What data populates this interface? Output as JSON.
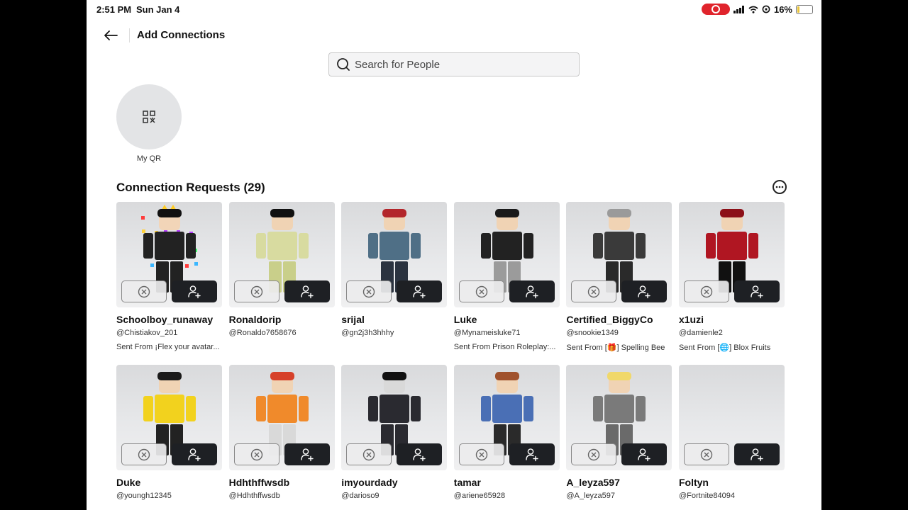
{
  "status": {
    "time": "2:51 PM",
    "date": "Sun Jan 4",
    "battery": "16%",
    "battery_level": 0.16
  },
  "header": {
    "title": "Add Connections"
  },
  "search": {
    "placeholder": "Search for People"
  },
  "qr": {
    "label": "My QR"
  },
  "section": {
    "title": "Connection Requests (29)"
  },
  "colors": {
    "accept_bg": "#1e2024",
    "record_red": "#e0242c",
    "tile_bg": "#e4e5e7"
  },
  "requests": [
    {
      "name": "Schoolboy_runaway",
      "handle": "@Chistiakov_201",
      "sent": "Sent From ¡Flex your avatar...",
      "shirt": "#222",
      "skin": "#f2d5b8",
      "pants": "#222",
      "hair": "#111",
      "deco": "rainbow"
    },
    {
      "name": "Ronaldorip",
      "handle": "@Ronaldo7658676",
      "sent": "",
      "shirt": "#d8dba0",
      "skin": "#f0d3b4",
      "pants": "#c9cf8a",
      "hair": "#111",
      "deco": ""
    },
    {
      "name": "srijal",
      "handle": "@gn2j3h3hhhy",
      "sent": "",
      "shirt": "#4f6f86",
      "skin": "#f0d3b4",
      "pants": "#2b3340",
      "hair": "#b3262b",
      "deco": ""
    },
    {
      "name": "Luke",
      "handle": "@Mynameisluke71",
      "sent": "Sent From Prison Roleplay:...",
      "shirt": "#222",
      "skin": "#f0d3b4",
      "pants": "#9b9b9b",
      "hair": "#1a1a1a",
      "deco": ""
    },
    {
      "name": "Certified_BiggyCo",
      "handle": "@snookie1349",
      "sent": "Sent From [🎁] Spelling Bee",
      "shirt": "#3a3a3a",
      "skin": "#f0d3b4",
      "pants": "#2a2a2a",
      "hair": "#9a9a9a",
      "deco": ""
    },
    {
      "name": "x1uzi",
      "handle": "@damienle2",
      "sent": "Sent From [🌐] Blox Fruits",
      "shirt": "#b01622",
      "skin": "#f0d3b4",
      "pants": "#111",
      "hair": "#8c1018",
      "deco": ""
    },
    {
      "name": "Duke",
      "handle": "@youngh12345",
      "sent": "",
      "shirt": "#f2d21e",
      "skin": "#f0d3b4",
      "pants": "#222",
      "hair": "#1a1a1a",
      "deco": ""
    },
    {
      "name": "Hdhthffwsdb",
      "handle": "@Hdhthffwsdb",
      "sent": "",
      "shirt": "#f08a2b",
      "skin": "#f0d3b4",
      "pants": "#d9d9d9",
      "hair": "#d6412a",
      "deco": ""
    },
    {
      "name": "imyourdady",
      "handle": "@darioso9",
      "sent": "",
      "shirt": "#2a2a30",
      "skin": "#d9d9d9",
      "pants": "#2a2a30",
      "hair": "#111",
      "deco": ""
    },
    {
      "name": "tamar",
      "handle": "@ariene65928",
      "sent": "",
      "shirt": "#4a6fb5",
      "skin": "#f0d3b4",
      "pants": "#2a2a2a",
      "hair": "#a0522d",
      "deco": ""
    },
    {
      "name": "A_leyza597",
      "handle": "@A_leyza597",
      "sent": "",
      "shirt": "#7a7a7a",
      "skin": "#f0d3b4",
      "pants": "#6a6a6a",
      "hair": "#f0d86a",
      "deco": ""
    },
    {
      "name": "Foltyn",
      "handle": "@Fortnite84094",
      "sent": "",
      "shirt": "",
      "skin": "",
      "pants": "",
      "hair": "",
      "deco": ""
    }
  ]
}
